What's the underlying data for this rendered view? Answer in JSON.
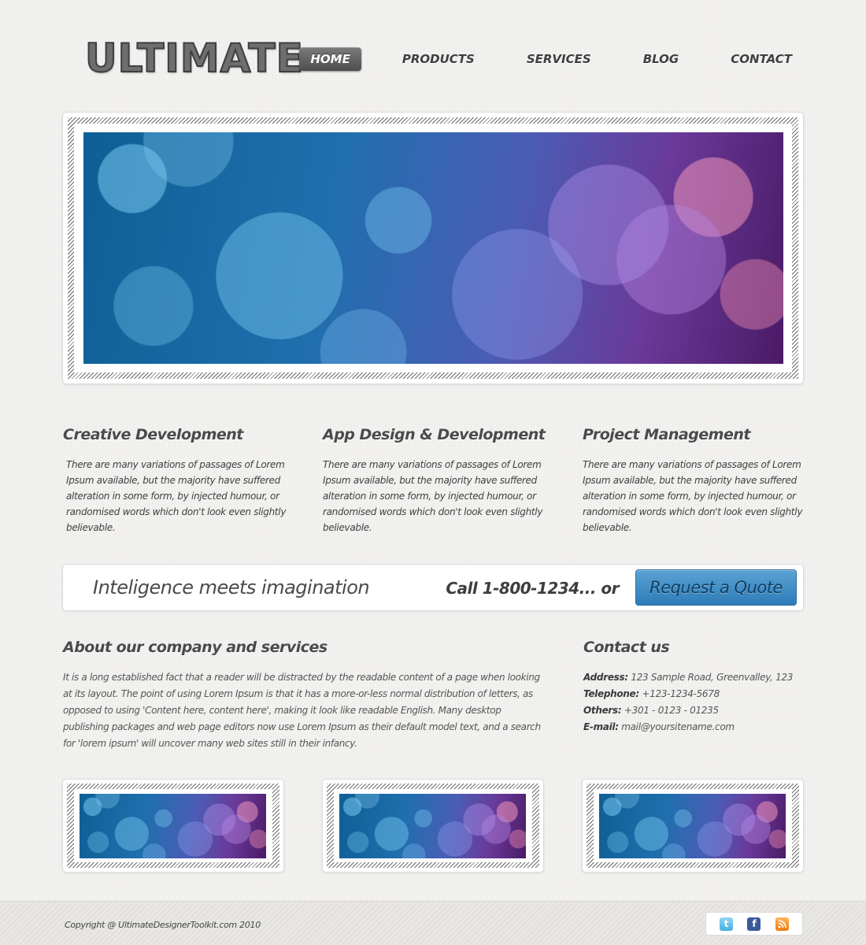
{
  "header": {
    "logo": "ULTIMATE",
    "nav": [
      {
        "label": "HOME",
        "active": true
      },
      {
        "label": "PRODUCTS",
        "active": false
      },
      {
        "label": "SERVICES",
        "active": false
      },
      {
        "label": "BLOG",
        "active": false
      },
      {
        "label": "CONTACT",
        "active": false
      }
    ]
  },
  "features": [
    {
      "title": "Creative Development",
      "text": "There are many variations of passages of Lorem Ipsum available, but the majority have suffered alteration in some form, by injected humour, or randomised words which don't look even slightly believable."
    },
    {
      "title": "App Design & Development",
      "text": "There are many variations of passages of Lorem Ipsum available, but the majority have suffered alteration in some form, by injected humour, or randomised words which don't look even slightly believable."
    },
    {
      "title": "Project Management",
      "text": "There are many variations of passages of Lorem Ipsum available, but the majority have suffered alteration in some form, by injected humour, or randomised words which don't look even slightly believable."
    }
  ],
  "cta": {
    "tagline": "Inteligence meets imagination",
    "phone": "Call 1-800-1234... or",
    "button": "Request a Quote"
  },
  "about": {
    "title": "About our company and services",
    "text": "It is a long established fact that a reader will be distracted by the readable content of a page when looking at its layout. The point of using Lorem Ipsum is that it has a more-or-less normal distribution of letters, as opposed to using 'Content here, content here', making it look like readable English. Many desktop publishing packages and web page editors now use Lorem Ipsum as their default model text, and a search for 'lorem ipsum' will uncover many web sites still in their infancy."
  },
  "contact": {
    "title": "Contact us",
    "items": [
      {
        "label": "Address:",
        "value": "123 Sample Road, Greenvalley, 123"
      },
      {
        "label": "Telephone:",
        "value": "+123-1234-5678"
      },
      {
        "label": "Others:",
        "value": "+301 - 0123 - 01235"
      },
      {
        "label": "E-mail:",
        "value": "mail@yoursitename.com"
      }
    ]
  },
  "footer": {
    "copyright": "Copyright @ UltimateDesignerToolkit.com 2010",
    "social_icons": [
      "twitter-icon",
      "facebook-icon",
      "rss-icon"
    ]
  },
  "colors": {
    "accent_blue": "#2e7cb8",
    "nav_active": "#5e5e5e",
    "text_dark": "#4a4a4a"
  }
}
